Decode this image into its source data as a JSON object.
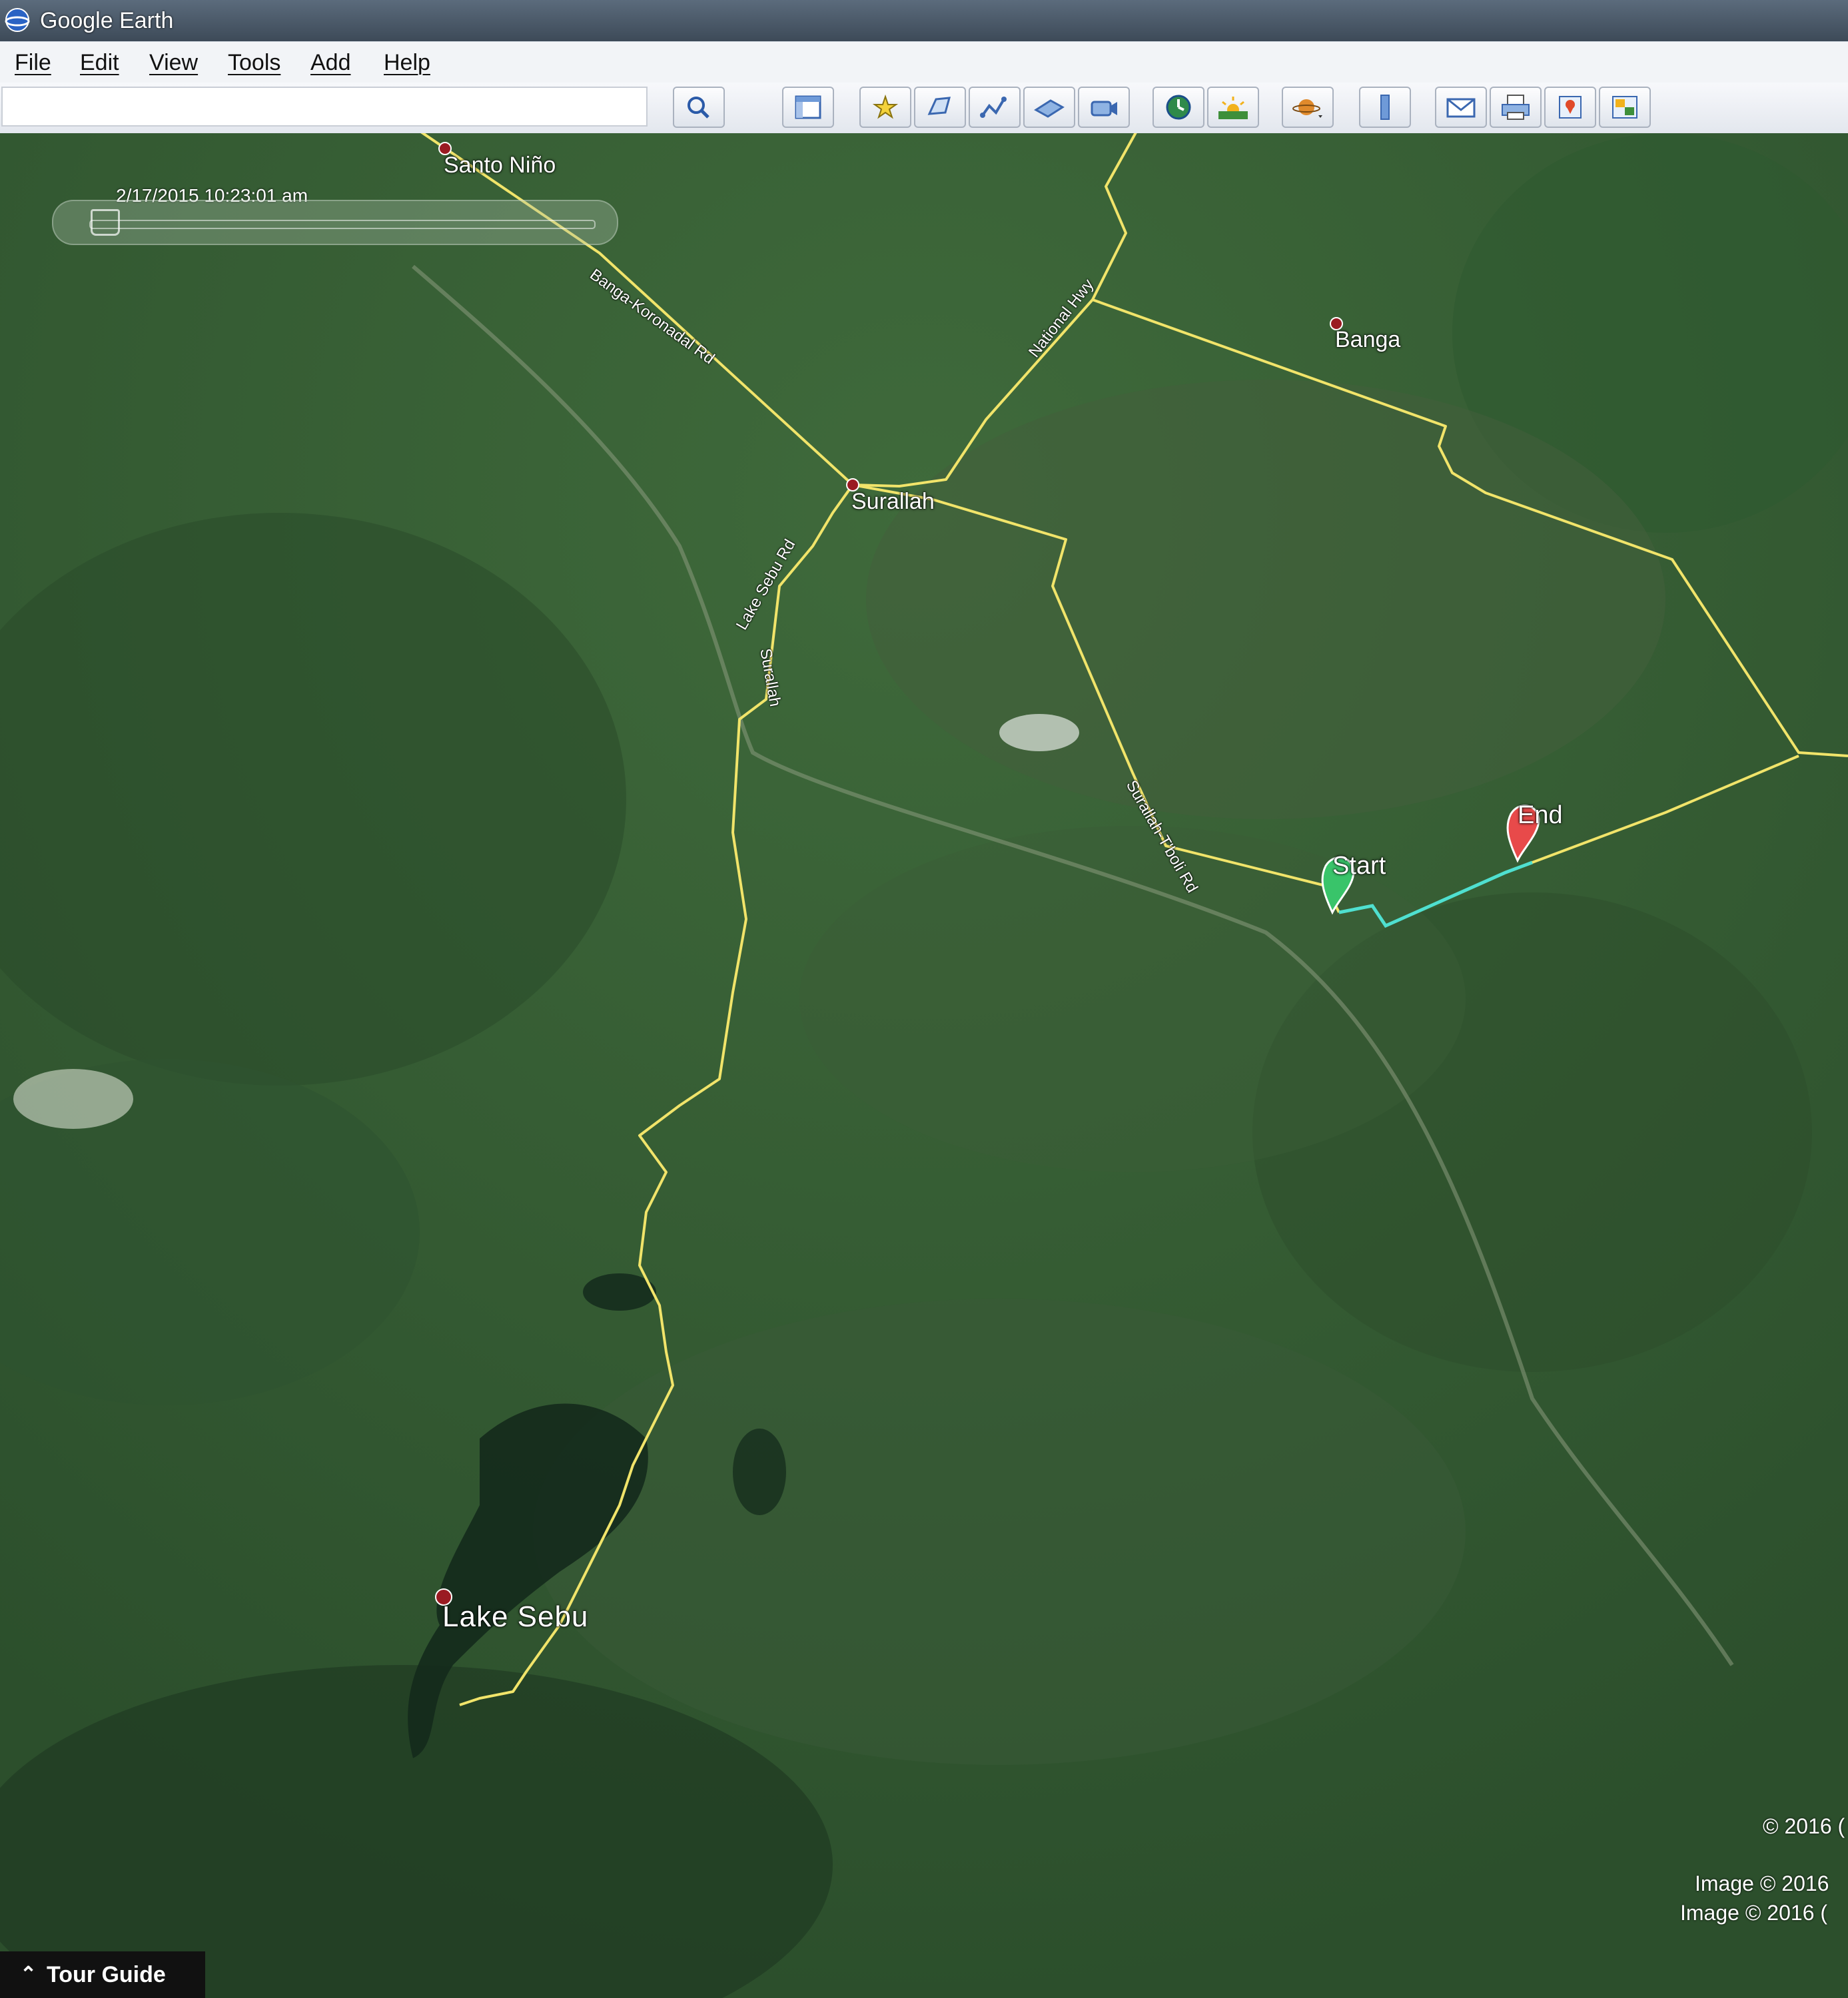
{
  "window": {
    "title": "Google Earth"
  },
  "menu": {
    "file": "File",
    "edit": "Edit",
    "view": "View",
    "tools": "Tools",
    "add": "Add",
    "help": "Help"
  },
  "search": {
    "value": ""
  },
  "toolbar": {
    "icons": [
      "search-icon",
      "sidebar-icon",
      "placemark-icon",
      "polygon-icon",
      "path-icon",
      "image-overlay-icon",
      "record-tour-icon",
      "historical-imagery-icon",
      "sunlight-icon",
      "planets-icon",
      "ruler-icon",
      "email-icon",
      "print-icon",
      "google-maps-icon",
      "save-image-icon"
    ]
  },
  "time_slider": {
    "datetime": "2/17/2015  10:23:01 am",
    "position": 0.0
  },
  "places": {
    "santo_nino": "Santo Niño",
    "banga": "Banga",
    "surallah": "Surallah",
    "lake_sebu": "Lake Sebu"
  },
  "roads": {
    "banga_koronadal": "Banga-Koronadal Rd",
    "national_hwy": "National Hwy",
    "lake_sebu_rd": "Lake Sebu Rd",
    "surallah_vertical": "Surallah",
    "surallah_tboli": "Surallah-T'boli Rd"
  },
  "pins": {
    "start": "Start",
    "end": "End"
  },
  "colors": {
    "road": "#f1e46a",
    "route": "#4fe0d0",
    "start_pin": "#39c46a",
    "end_pin": "#e84a4a",
    "place_dot": "#9a1b22"
  },
  "copyright": {
    "line1": "© 2016 (",
    "line2": "Image © 2016",
    "line3": "Image © 2016 ("
  },
  "tour_guide": {
    "label": "Tour Guide"
  }
}
